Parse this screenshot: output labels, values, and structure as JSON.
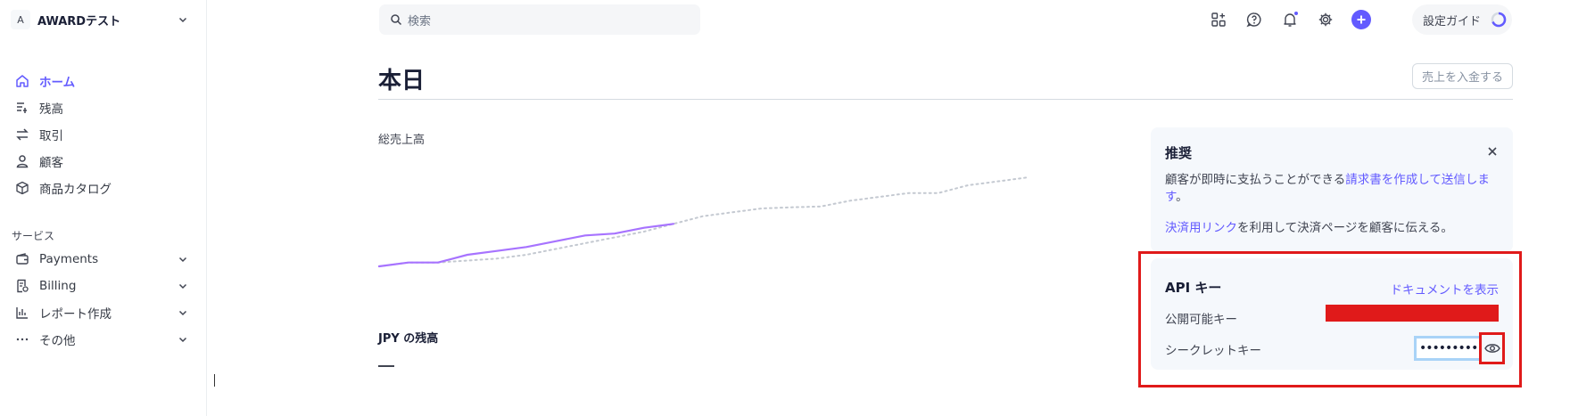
{
  "account": {
    "initial": "A",
    "name": "AWARDテスト"
  },
  "nav": {
    "home": "ホーム",
    "balance": "残高",
    "transactions": "取引",
    "customers": "顧客",
    "catalog": "商品カタログ"
  },
  "services": {
    "label": "サービス",
    "payments": "Payments",
    "billing": "Billing",
    "reports": "レポート作成",
    "more": "その他"
  },
  "search": {
    "placeholder": "検索"
  },
  "topbar": {
    "guide_label": "設定ガイド"
  },
  "page": {
    "title": "本日",
    "payout_button": "売上を入金する",
    "gross_label": "総売上高",
    "balance_label": "JPY の残高"
  },
  "recommendation": {
    "title": "推奨",
    "text1_a": "顧客が即時に支払うことができる",
    "text1_link": "請求書を作成して送信します",
    "text1_b": "。",
    "text2_link": "決済用リンク",
    "text2_b": "を利用して決済ページを顧客に伝える。"
  },
  "api": {
    "title": "API キー",
    "docs_link": "ドキュメントを表示",
    "publishable_label": "公開可能キー",
    "secret_label": "シークレットキー",
    "secret_value": "••••••••••••"
  },
  "colors": {
    "accent": "#635bff",
    "highlight": "#e01a1a",
    "focus": "#a9d3f7"
  },
  "chart_data": {
    "type": "line",
    "series": [
      {
        "values": [
          0,
          1,
          1,
          3,
          4,
          5,
          6.5,
          8,
          8.5,
          10,
          11
        ]
      },
      {
        "values": [
          0,
          1,
          1,
          1.5,
          2,
          3,
          4.5,
          6,
          7.5,
          9,
          11,
          13,
          14,
          15,
          15.3,
          15.5,
          17,
          18,
          19,
          19,
          21,
          22,
          23
        ]
      }
    ]
  }
}
